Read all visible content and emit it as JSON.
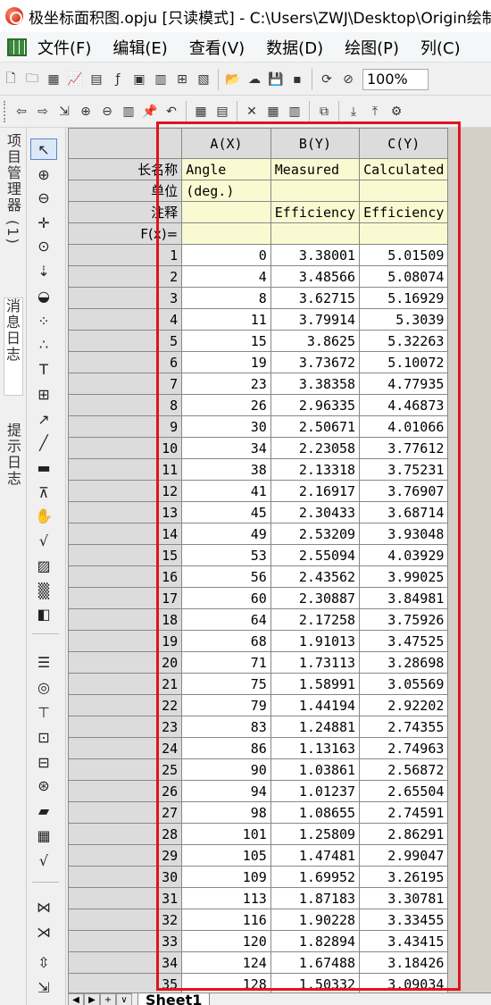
{
  "window": {
    "title": "极坐标面积图.opju [只读模式] - C:\\Users\\ZWJ\\Desktop\\Origin绘制"
  },
  "menu": [
    "文件(F)",
    "编辑(E)",
    "查看(V)",
    "数据(D)",
    "绘图(P)",
    "列(C)"
  ],
  "toolbar": {
    "zoom": "100%"
  },
  "side_tabs": [
    "项目管理器 (1)",
    "消息日志",
    "提示日志"
  ],
  "worksheet": {
    "columns": [
      {
        "header": "A(X)",
        "long_name": "Angle",
        "units": "(deg.)",
        "comments": ""
      },
      {
        "header": "B(Y)",
        "long_name": "Measured",
        "units": "",
        "comments": "Efficiency"
      },
      {
        "header": "C(Y)",
        "long_name": "Calculated",
        "units": "",
        "comments": "Efficiency"
      }
    ],
    "meta_labels": {
      "long_name": "长名称",
      "units": "单位",
      "comments": "注释",
      "fx": "F(x)="
    },
    "rows": [
      [
        "1",
        "0",
        "3.38001",
        "5.01509"
      ],
      [
        "2",
        "4",
        "3.48566",
        "5.08074"
      ],
      [
        "3",
        "8",
        "3.62715",
        "5.16929"
      ],
      [
        "4",
        "11",
        "3.79914",
        "5.3039"
      ],
      [
        "5",
        "15",
        "3.8625",
        "5.32263"
      ],
      [
        "6",
        "19",
        "3.73672",
        "5.10072"
      ],
      [
        "7",
        "23",
        "3.38358",
        "4.77935"
      ],
      [
        "8",
        "26",
        "2.96335",
        "4.46873"
      ],
      [
        "9",
        "30",
        "2.50671",
        "4.01066"
      ],
      [
        "10",
        "34",
        "2.23058",
        "3.77612"
      ],
      [
        "11",
        "38",
        "2.13318",
        "3.75231"
      ],
      [
        "12",
        "41",
        "2.16917",
        "3.76907"
      ],
      [
        "13",
        "45",
        "2.30433",
        "3.68714"
      ],
      [
        "14",
        "49",
        "2.53209",
        "3.93048"
      ],
      [
        "15",
        "53",
        "2.55094",
        "4.03929"
      ],
      [
        "16",
        "56",
        "2.43562",
        "3.99025"
      ],
      [
        "17",
        "60",
        "2.30887",
        "3.84981"
      ],
      [
        "18",
        "64",
        "2.17258",
        "3.75926"
      ],
      [
        "19",
        "68",
        "1.91013",
        "3.47525"
      ],
      [
        "20",
        "71",
        "1.73113",
        "3.28698"
      ],
      [
        "21",
        "75",
        "1.58991",
        "3.05569"
      ],
      [
        "22",
        "79",
        "1.44194",
        "2.92202"
      ],
      [
        "23",
        "83",
        "1.24881",
        "2.74355"
      ],
      [
        "24",
        "86",
        "1.13163",
        "2.74963"
      ],
      [
        "25",
        "90",
        "1.03861",
        "2.56872"
      ],
      [
        "26",
        "94",
        "1.01237",
        "2.65504"
      ],
      [
        "27",
        "98",
        "1.08655",
        "2.74591"
      ],
      [
        "28",
        "101",
        "1.25809",
        "2.86291"
      ],
      [
        "29",
        "105",
        "1.47481",
        "2.99047"
      ],
      [
        "30",
        "109",
        "1.69952",
        "3.26195"
      ],
      [
        "31",
        "113",
        "1.87183",
        "3.30781"
      ],
      [
        "32",
        "116",
        "1.90228",
        "3.33455"
      ],
      [
        "33",
        "120",
        "1.82894",
        "3.43415"
      ],
      [
        "34",
        "124",
        "1.67488",
        "3.18426"
      ],
      [
        "35",
        "128",
        "1.50332",
        "3.09034"
      ]
    ]
  },
  "sheet_tabs": [
    "Sheet1"
  ],
  "colors": {
    "highlight": "#e0141e",
    "meta_bg": "#fafad2"
  }
}
